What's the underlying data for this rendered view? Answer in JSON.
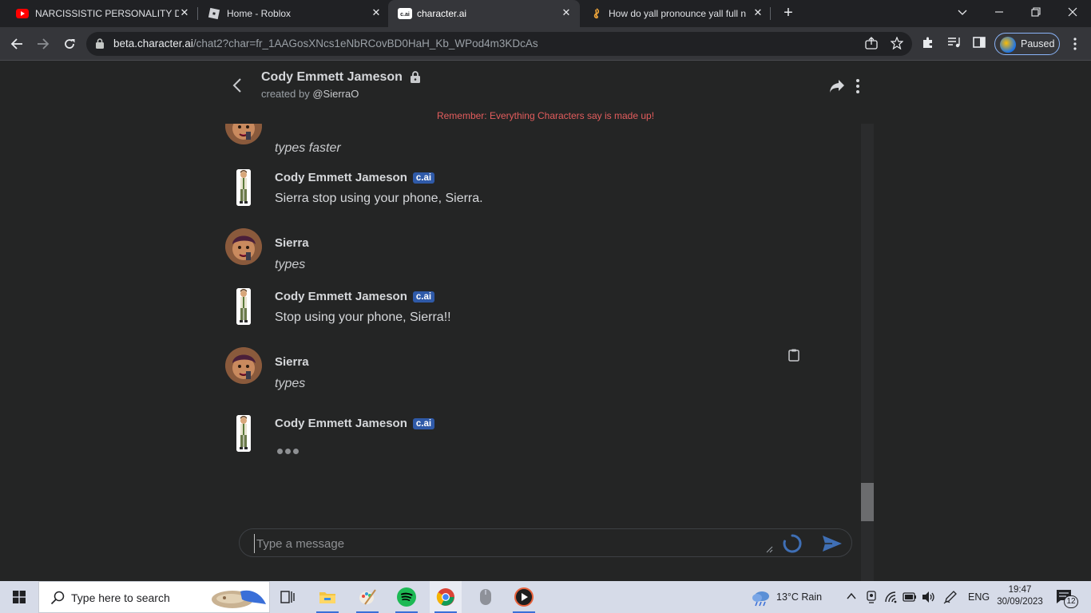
{
  "browser": {
    "tabs": [
      {
        "title": "NARCISSISTIC PERSONALITY DIS",
        "close": "✕",
        "favicon": "youtube-icon"
      },
      {
        "title": "Home - Roblox",
        "close": "✕",
        "favicon": "roblox-icon"
      },
      {
        "title": "character.ai",
        "close": "✕",
        "favicon": "character-ai-icon",
        "active": true
      },
      {
        "title": "How do yall pronounce yall full n",
        "close": "✕",
        "favicon": "music-note-icon"
      }
    ],
    "new_tab": "+",
    "url_host": "beta.character.ai",
    "url_path": "/chat2?char=fr_1AAGosXNcs1eNbRCovBD0HaH_Kb_WPod4m3KDcAs",
    "profile_label": "Paused"
  },
  "chat": {
    "character_name": "Cody Emmett Jameson",
    "created_by_prefix": "created by ",
    "creator_handle": "@SierraO",
    "disclaimer": "Remember: Everything Characters say is made up!",
    "badge": "c.ai",
    "messages": [
      {
        "author": "",
        "text": "types faster",
        "role": "user"
      },
      {
        "author": "Cody Emmett Jameson",
        "text": "Sierra stop using your phone, Sierra.",
        "role": "character"
      },
      {
        "author": "Sierra",
        "text": "types",
        "role": "user"
      },
      {
        "author": "Cody Emmett Jameson",
        "text": "Stop using your phone, Sierra!!",
        "role": "character"
      },
      {
        "author": "Sierra",
        "text": "types",
        "role": "user"
      },
      {
        "author": "Cody Emmett Jameson",
        "text": "",
        "role": "character",
        "typing": true
      }
    ],
    "composer_placeholder": "Type a message"
  },
  "taskbar": {
    "search_placeholder": "Type here to search",
    "weather": "13°C  Rain",
    "language": "ENG",
    "time": "19:47",
    "date": "30/09/2023",
    "notifications": "12"
  },
  "colors": {
    "page_bg": "#242525",
    "disclaimer": "#e35d5d",
    "badge_bg": "#2f5aa8",
    "send": "#3f6fb5"
  }
}
